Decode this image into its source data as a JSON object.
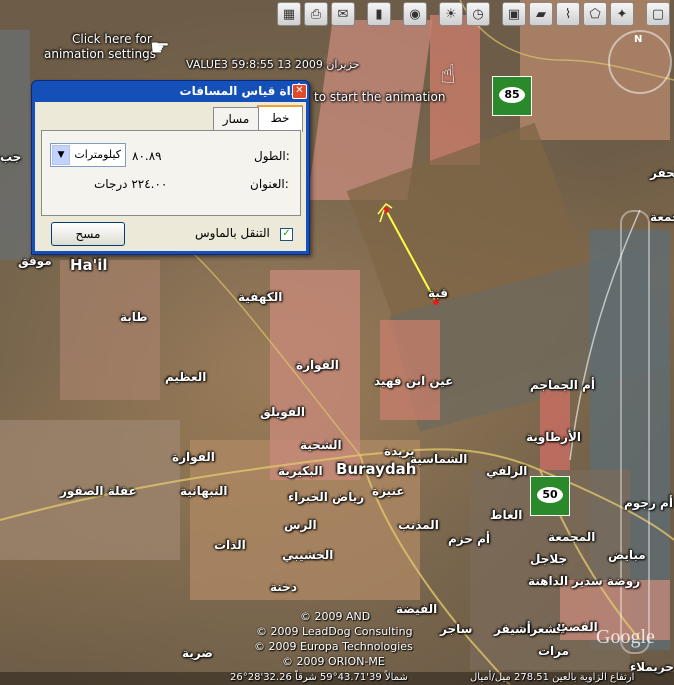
{
  "toolbar": {
    "icons": [
      "sidebar-toggle-icon",
      "placemark-icon",
      "polygon-icon",
      "path-icon",
      "image-overlay-icon",
      "record-tour-icon",
      "sun-icon",
      "historical-imagery-icon",
      "planet-icon",
      "ruler-icon",
      "email-icon",
      "print-icon",
      "view-in-maps-icon"
    ]
  },
  "animation": {
    "hint1": "Click here for",
    "hint2": "animation settings",
    "timestamp": "VALUE3 59:8:55 13 حزيران 2009",
    "hint3": "to start the animation"
  },
  "dialog": {
    "title": "أداة قياس المسافات",
    "close": "✕",
    "tab_line": "خط",
    "tab_path": "مسار",
    "length_label": "الطول:",
    "length_value": "٨٠.٨٩",
    "unit_selected": "كيلومترات",
    "heading_label": "العنوان:",
    "heading_value": "٢٢٤.٠٠ درجات",
    "mouse_nav": "التنقل بالماوس",
    "mouse_nav_checked": true,
    "clear": "مسح"
  },
  "labels": {
    "hail": "Ha'il",
    "hail_ar": "موقق",
    "kahfa": "الكهفية",
    "talla": "طابة",
    "azim": "العظيم",
    "qawara": "القوارة",
    "fuwailiq": "الفويلق",
    "shahiya": "الشحية",
    "buraydah_ar": "بريدة",
    "buraydah": "Buraydah",
    "bukayriyah": "البكيرية",
    "shamasiya": "الشماسية",
    "riyadh_khabra": "رياض الخبراء",
    "unaizah": "عنيزة",
    "fawara": "الفوارة",
    "saqour": "عقلة الصقور",
    "nabhaniyah": "النبهانية",
    "ras": "الرس",
    "thath": "الذات",
    "mudhnab": "المذنب",
    "um_hazm": "أم حزم",
    "khashibi": "الخشيبي",
    "dakhna": "دخنة",
    "fayda": "الفيضة",
    "sajir": "ساجر",
    "shara": "الشعراء",
    "ashiqar": "أشيقر",
    "qasab": "القصب",
    "marat": "مرات",
    "dariya": "ضرية",
    "ain_ibn_fahid": "عين ابن فهيد",
    "um_jamajim": "أم الجماجم",
    "artawiya": "الأرطاوية",
    "zulfi": "الزلفي",
    "ghat": "الغاط",
    "majmaah": "المجمعة",
    "jalajil": "جلاجل",
    "rawdat": "روضة سدير",
    "dahina": "الداهنة",
    "mubayidh": "مبايض",
    "um_rujum": "أم رجوم",
    "qibah": "قبة",
    "huraymila": "حريملاء",
    "hafr": "الحفر",
    "jumah": "الجمعة",
    "jub": "جب"
  },
  "route_shields": {
    "r85": "85",
    "r50": "50"
  },
  "compass": "N",
  "copyrights": [
    "© 2009 AND",
    "© 2009 LeadDog Consulting",
    "© 2009 Europa Technologies",
    "© 2009 ORION-ME"
  ],
  "google_logo": "Google",
  "status": {
    "coords": "26°28'32.26 شمالاً   39'43.71°59 شرقاً",
    "elev": "ارتفاع الزاوية بالعين 278.51 ميل/أميال"
  }
}
